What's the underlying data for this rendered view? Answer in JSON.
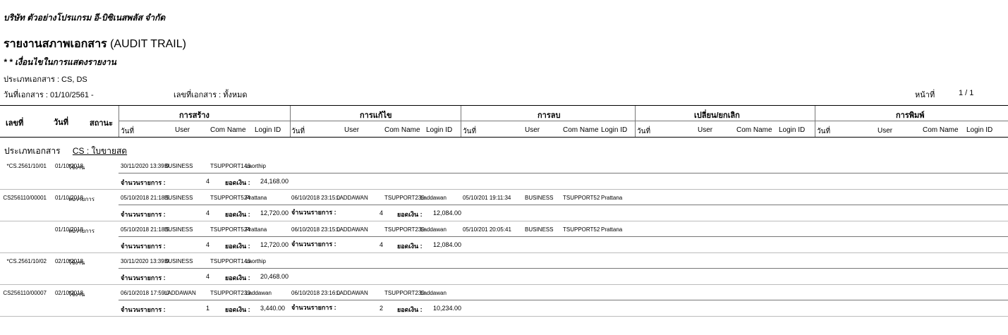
{
  "report": {
    "company": "บริษัท ตัวอย่างโปรแกรม อี-บิซิเนสพลัส จำกัด",
    "title_th": "รายงานสภาพเอกสาร",
    "title_en": "(AUDIT TRAIL)",
    "conditions": "* * เงื่อนไขในการแสดงรายงาน",
    "doc_types": "ประเภทเอกสาร : CS, DS",
    "doc_date": "วันที่เอกสาร : 01/10/2561 -",
    "doc_no": "เลขที่เอกสาร : ทั้งหมด",
    "page_label": "หน้าที่",
    "page_value": "1  /  1"
  },
  "header": {
    "doc_no": "เลขที่",
    "date": "วันที่",
    "status": "สถานะ",
    "groups": [
      "การสร้าง",
      "การแก้ไข",
      "การลบ",
      "เปลี่ยน/ยกเลิก",
      "การพิมพ์"
    ],
    "sub": [
      "วันที่",
      "User",
      "Com Name",
      "Login ID"
    ]
  },
  "group": {
    "label": "ประเภทเอกสาร",
    "doc": "CS : ใบขายสด"
  },
  "labels": {
    "count": "จำนวนรายการ :",
    "amount": "ยอดเงิน :"
  },
  "rows": [
    {
      "doc": "*CS.2561/10/01",
      "date": "01/10/2018",
      "status": "ใช้งาน",
      "c_dt": "30/11/2020  13:39:0",
      "c_user": "BUSINESS",
      "c_com": "TSUPPORT146",
      "c_login": "Laorthip",
      "e_dt": "",
      "e_user": "",
      "e_com": "",
      "e_login": "",
      "d_dt": "",
      "d_user": "",
      "d_com": "",
      "d_login": "",
      "t1_count": "4",
      "t1_amount": "24,168.00",
      "t2_count": "",
      "t2_amount": ""
    },
    {
      "doc": "CS256110/00001",
      "date": "01/10/2018",
      "status": "ลบรายการ",
      "c_dt": "05/10/2018  21:18:5",
      "c_user": "BUSINESS",
      "c_com": "TSUPPORT524",
      "c_login": "Prattana",
      "e_dt": "06/10/2018  23:15:0",
      "e_user": "LADDAWAN",
      "e_com": "TSUPPORT239",
      "e_login": "Laddawan",
      "d_dt": "05/10/201   19:11:34",
      "d_user": "BUSINESS",
      "d_com": "TSUPPORT52",
      "d_login": "Prattana",
      "t1_count": "4",
      "t1_amount": "12,720.00",
      "t2_count": "4",
      "t2_amount": "12,084.00"
    },
    {
      "doc": "",
      "date": "01/10/2018",
      "status": "ลบรายการ",
      "c_dt": "05/10/2018  21:18:5",
      "c_user": "BUSINESS",
      "c_com": "TSUPPORT524",
      "c_login": "Prattana",
      "e_dt": "06/10/2018  23:15:0",
      "e_user": "LADDAWAN",
      "e_com": "TSUPPORT239",
      "e_login": "Laddawan",
      "d_dt": "05/10/201   20:05:41",
      "d_user": "BUSINESS",
      "d_com": "TSUPPORT52",
      "d_login": "Prattana",
      "t1_count": "4",
      "t1_amount": "12,720.00",
      "t2_count": "4",
      "t2_amount": "12,084.00"
    },
    {
      "doc": "*CS.2561/10/02",
      "date": "02/10/2018",
      "status": "ใช้งาน",
      "c_dt": "30/11/2020  13:39:0",
      "c_user": "BUSINESS",
      "c_com": "TSUPPORT146",
      "c_login": "Laorthip",
      "e_dt": "",
      "e_user": "",
      "e_com": "",
      "e_login": "",
      "d_dt": "",
      "d_user": "",
      "d_com": "",
      "d_login": "",
      "t1_count": "4",
      "t1_amount": "20,468.00",
      "t2_count": "",
      "t2_amount": ""
    },
    {
      "doc": "CS256110/00007",
      "date": "02/10/2018",
      "status": "ใช้งาน",
      "c_dt": "06/10/2018  17:59:0",
      "c_user": "LADDAWAN",
      "c_com": "TSUPPORT239",
      "c_login": "Laddawan",
      "e_dt": "06/10/2018  23:16:0",
      "e_user": "LADDAWAN",
      "e_com": "TSUPPORT239",
      "e_login": "Laddawan",
      "d_dt": "",
      "d_user": "",
      "d_com": "",
      "d_login": "",
      "t1_count": "1",
      "t1_amount": "3,440.00",
      "t2_count": "2",
      "t2_amount": "10,234.00"
    }
  ]
}
